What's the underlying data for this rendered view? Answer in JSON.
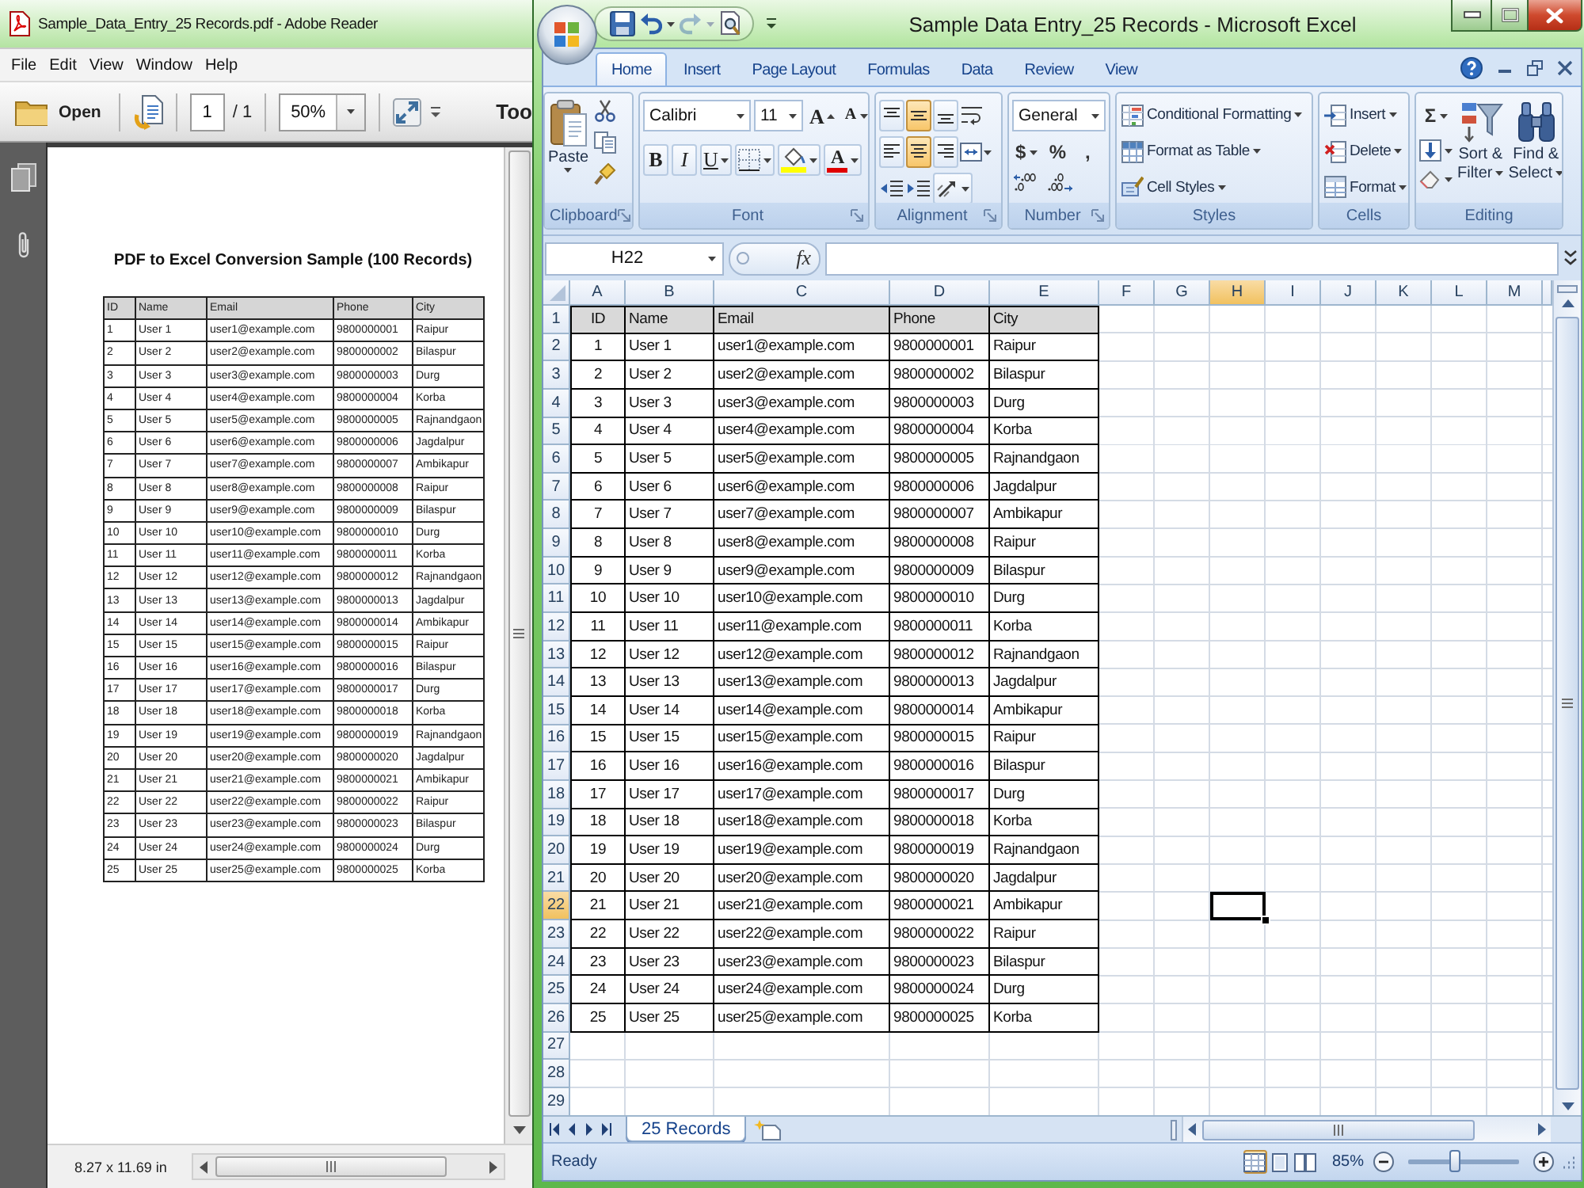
{
  "reader": {
    "title": "Sample_Data_Entry_25 Records.pdf - Adobe Reader",
    "menu": [
      "File",
      "Edit",
      "View",
      "Window",
      "Help"
    ],
    "toolbar": {
      "open": "Open",
      "page": "1",
      "page_total": "/ 1",
      "zoom": "50%",
      "tools": "Too"
    },
    "document": {
      "title": "PDF to Excel Conversion Sample (100 Records)",
      "columns": [
        "ID",
        "Name",
        "Email",
        "Phone",
        "City"
      ],
      "rows": [
        [
          "1",
          "User 1",
          "user1@example.com",
          "9800000001",
          "Raipur"
        ],
        [
          "2",
          "User 2",
          "user2@example.com",
          "9800000002",
          "Bilaspur"
        ],
        [
          "3",
          "User 3",
          "user3@example.com",
          "9800000003",
          "Durg"
        ],
        [
          "4",
          "User 4",
          "user4@example.com",
          "9800000004",
          "Korba"
        ],
        [
          "5",
          "User 5",
          "user5@example.com",
          "9800000005",
          "Rajnandgaon"
        ],
        [
          "6",
          "User 6",
          "user6@example.com",
          "9800000006",
          "Jagdalpur"
        ],
        [
          "7",
          "User 7",
          "user7@example.com",
          "9800000007",
          "Ambikapur"
        ],
        [
          "8",
          "User 8",
          "user8@example.com",
          "9800000008",
          "Raipur"
        ],
        [
          "9",
          "User 9",
          "user9@example.com",
          "9800000009",
          "Bilaspur"
        ],
        [
          "10",
          "User 10",
          "user10@example.com",
          "9800000010",
          "Durg"
        ],
        [
          "11",
          "User 11",
          "user11@example.com",
          "9800000011",
          "Korba"
        ],
        [
          "12",
          "User 12",
          "user12@example.com",
          "9800000012",
          "Rajnandgaon"
        ],
        [
          "13",
          "User 13",
          "user13@example.com",
          "9800000013",
          "Jagdalpur"
        ],
        [
          "14",
          "User 14",
          "user14@example.com",
          "9800000014",
          "Ambikapur"
        ],
        [
          "15",
          "User 15",
          "user15@example.com",
          "9800000015",
          "Raipur"
        ],
        [
          "16",
          "User 16",
          "user16@example.com",
          "9800000016",
          "Bilaspur"
        ],
        [
          "17",
          "User 17",
          "user17@example.com",
          "9800000017",
          "Durg"
        ],
        [
          "18",
          "User 18",
          "user18@example.com",
          "9800000018",
          "Korba"
        ],
        [
          "19",
          "User 19",
          "user19@example.com",
          "9800000019",
          "Rajnandgaon"
        ],
        [
          "20",
          "User 20",
          "user20@example.com",
          "9800000020",
          "Jagdalpur"
        ],
        [
          "21",
          "User 21",
          "user21@example.com",
          "9800000021",
          "Ambikapur"
        ],
        [
          "22",
          "User 22",
          "user22@example.com",
          "9800000022",
          "Raipur"
        ],
        [
          "23",
          "User 23",
          "user23@example.com",
          "9800000023",
          "Bilaspur"
        ],
        [
          "24",
          "User 24",
          "user24@example.com",
          "9800000024",
          "Durg"
        ],
        [
          "25",
          "User 25",
          "user25@example.com",
          "9800000025",
          "Korba"
        ]
      ]
    },
    "status": {
      "page_size": "8.27 x 11.69 in"
    }
  },
  "excel": {
    "title": "Sample Data Entry_25 Records - Microsoft Excel",
    "quick_access": [
      {
        "kind": "save",
        "disabled": false
      },
      {
        "kind": "undo",
        "disabled": false
      },
      {
        "kind": "redo",
        "disabled": true
      },
      {
        "kind": "print_preview",
        "disabled": false
      }
    ],
    "tabs": [
      {
        "label": "Home",
        "selected": true
      },
      {
        "label": "Insert",
        "selected": false
      },
      {
        "label": "Page Layout",
        "selected": false
      },
      {
        "label": "Formulas",
        "selected": false
      },
      {
        "label": "Data",
        "selected": false
      },
      {
        "label": "Review",
        "selected": false
      },
      {
        "label": "View",
        "selected": false
      }
    ],
    "ribbon": {
      "clipboard": {
        "label": "Clipboard",
        "paste": "Paste"
      },
      "font": {
        "label": "Font",
        "family": "Calibri",
        "size": "11",
        "grow": "A",
        "shrink": "A",
        "bold": "B",
        "italic": "I",
        "underline": "U",
        "font_color": "A"
      },
      "alignment": {
        "label": "Alignment",
        "vertical": [
          {
            "kind": "top",
            "selected": false
          },
          {
            "kind": "middle",
            "selected": true
          },
          {
            "kind": "bottom",
            "selected": false
          }
        ],
        "horizontal": [
          {
            "kind": "left",
            "selected": false
          },
          {
            "kind": "center",
            "selected": true
          },
          {
            "kind": "right",
            "selected": false
          }
        ]
      },
      "number": {
        "label": "Number",
        "format": "General",
        "currency": "$",
        "percent": "%",
        "comma": ","
      },
      "styles": {
        "label": "Styles",
        "buttons": [
          {
            "kind": "conditional",
            "label": "Conditional Formatting"
          },
          {
            "kind": "table",
            "label": "Format as Table"
          },
          {
            "kind": "cell",
            "label": "Cell Styles"
          }
        ]
      },
      "cells": {
        "label": "Cells",
        "buttons": [
          {
            "kind": "insert",
            "label": "Insert"
          },
          {
            "kind": "delete",
            "label": "Delete"
          },
          {
            "kind": "format",
            "label": "Format"
          }
        ]
      },
      "editing": {
        "label": "Editing",
        "sum": "Σ",
        "sort_filter": [
          "Sort &",
          "Filter"
        ],
        "find_select": [
          "Find &",
          "Select"
        ]
      }
    },
    "name_box": "H22",
    "function_label": "fx",
    "columns": [
      {
        "label": "A",
        "selected": false
      },
      {
        "label": "B",
        "selected": false
      },
      {
        "label": "C",
        "selected": false
      },
      {
        "label": "D",
        "selected": false
      },
      {
        "label": "E",
        "selected": false
      },
      {
        "label": "F",
        "selected": false
      },
      {
        "label": "G",
        "selected": false
      },
      {
        "label": "H",
        "selected": true
      },
      {
        "label": "I",
        "selected": false
      },
      {
        "label": "J",
        "selected": false
      },
      {
        "label": "K",
        "selected": false
      },
      {
        "label": "L",
        "selected": false
      },
      {
        "label": "M",
        "selected": false
      }
    ],
    "row_headers": [
      {
        "label": "1",
        "selected": false
      },
      {
        "label": "2",
        "selected": false
      },
      {
        "label": "3",
        "selected": false
      },
      {
        "label": "4",
        "selected": false
      },
      {
        "label": "5",
        "selected": false
      },
      {
        "label": "6",
        "selected": false
      },
      {
        "label": "7",
        "selected": false
      },
      {
        "label": "8",
        "selected": false
      },
      {
        "label": "9",
        "selected": false
      },
      {
        "label": "10",
        "selected": false
      },
      {
        "label": "11",
        "selected": false
      },
      {
        "label": "12",
        "selected": false
      },
      {
        "label": "13",
        "selected": false
      },
      {
        "label": "14",
        "selected": false
      },
      {
        "label": "15",
        "selected": false
      },
      {
        "label": "16",
        "selected": false
      },
      {
        "label": "17",
        "selected": false
      },
      {
        "label": "18",
        "selected": false
      },
      {
        "label": "19",
        "selected": false
      },
      {
        "label": "20",
        "selected": false
      },
      {
        "label": "21",
        "selected": false
      },
      {
        "label": "22",
        "selected": true
      },
      {
        "label": "23",
        "selected": false
      },
      {
        "label": "24",
        "selected": false
      },
      {
        "label": "25",
        "selected": false
      },
      {
        "label": "26",
        "selected": false
      },
      {
        "label": "27",
        "selected": false
      },
      {
        "label": "28",
        "selected": false
      },
      {
        "label": "29",
        "selected": false
      }
    ],
    "table": {
      "columns": [
        "ID",
        "Name",
        "Email",
        "Phone",
        "City"
      ],
      "rows": [
        [
          "1",
          "User 1",
          "user1@example.com",
          "9800000001",
          "Raipur"
        ],
        [
          "2",
          "User 2",
          "user2@example.com",
          "9800000002",
          "Bilaspur"
        ],
        [
          "3",
          "User 3",
          "user3@example.com",
          "9800000003",
          "Durg"
        ],
        [
          "4",
          "User 4",
          "user4@example.com",
          "9800000004",
          "Korba"
        ],
        [
          "5",
          "User 5",
          "user5@example.com",
          "9800000005",
          "Rajnandgaon"
        ],
        [
          "6",
          "User 6",
          "user6@example.com",
          "9800000006",
          "Jagdalpur"
        ],
        [
          "7",
          "User 7",
          "user7@example.com",
          "9800000007",
          "Ambikapur"
        ],
        [
          "8",
          "User 8",
          "user8@example.com",
          "9800000008",
          "Raipur"
        ],
        [
          "9",
          "User 9",
          "user9@example.com",
          "9800000009",
          "Bilaspur"
        ],
        [
          "10",
          "User 10",
          "user10@example.com",
          "9800000010",
          "Durg"
        ],
        [
          "11",
          "User 11",
          "user11@example.com",
          "9800000011",
          "Korba"
        ],
        [
          "12",
          "User 12",
          "user12@example.com",
          "9800000012",
          "Rajnandgaon"
        ],
        [
          "13",
          "User 13",
          "user13@example.com",
          "9800000013",
          "Jagdalpur"
        ],
        [
          "14",
          "User 14",
          "user14@example.com",
          "9800000014",
          "Ambikapur"
        ],
        [
          "15",
          "User 15",
          "user15@example.com",
          "9800000015",
          "Raipur"
        ],
        [
          "16",
          "User 16",
          "user16@example.com",
          "9800000016",
          "Bilaspur"
        ],
        [
          "17",
          "User 17",
          "user17@example.com",
          "9800000017",
          "Durg"
        ],
        [
          "18",
          "User 18",
          "user18@example.com",
          "9800000018",
          "Korba"
        ],
        [
          "19",
          "User 19",
          "user19@example.com",
          "9800000019",
          "Rajnandgaon"
        ],
        [
          "20",
          "User 20",
          "user20@example.com",
          "9800000020",
          "Jagdalpur"
        ],
        [
          "21",
          "User 21",
          "user21@example.com",
          "9800000021",
          "Ambikapur"
        ],
        [
          "22",
          "User 22",
          "user22@example.com",
          "9800000022",
          "Raipur"
        ],
        [
          "23",
          "User 23",
          "user23@example.com",
          "9800000023",
          "Bilaspur"
        ],
        [
          "24",
          "User 24",
          "user24@example.com",
          "9800000024",
          "Durg"
        ],
        [
          "25",
          "User 25",
          "user25@example.com",
          "9800000025",
          "Korba"
        ]
      ]
    },
    "sheet_tabs": [
      {
        "label": "25 Records",
        "selected": true
      }
    ],
    "status": {
      "text": "Ready",
      "views": [
        {
          "kind": "normal",
          "selected": true
        },
        {
          "kind": "page_layout",
          "selected": false
        },
        {
          "kind": "page_break",
          "selected": false
        }
      ],
      "zoom": {
        "label": "85%",
        "level": 0.42
      }
    }
  }
}
